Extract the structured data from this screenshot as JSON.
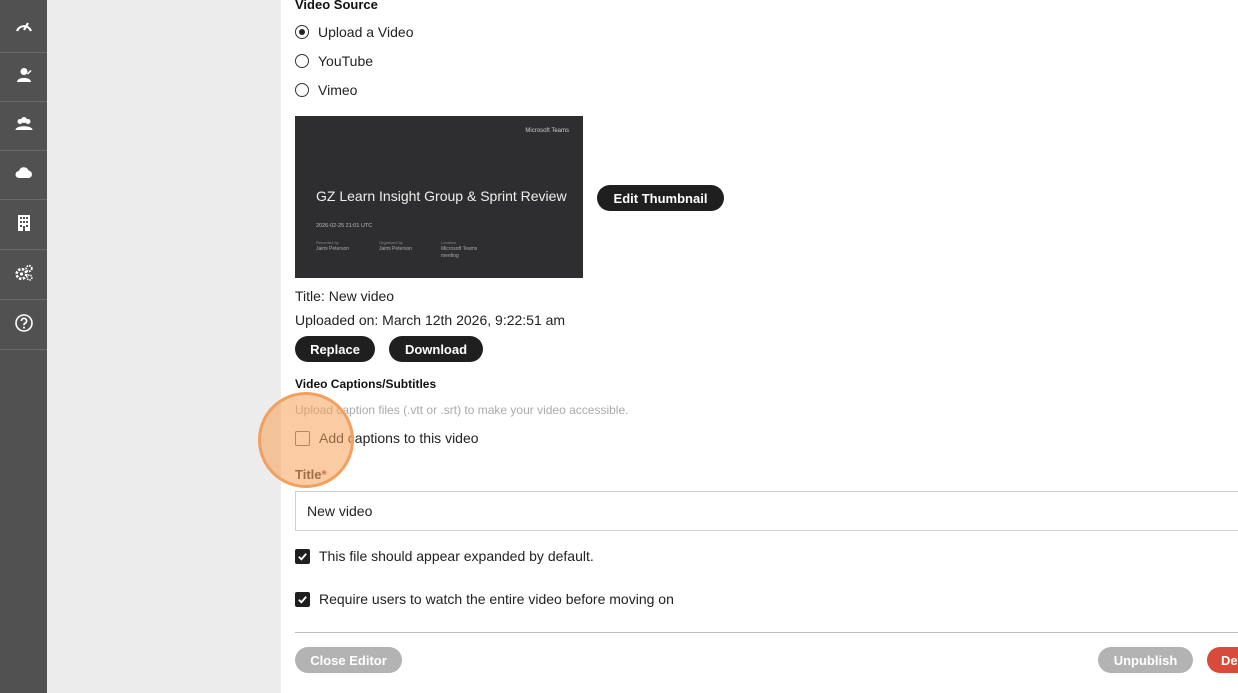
{
  "sidebar": {
    "items": [
      {
        "icon": "speedometer-icon"
      },
      {
        "icon": "user-icon"
      },
      {
        "icon": "users-group-icon"
      },
      {
        "icon": "cloud-icon"
      },
      {
        "icon": "building-icon"
      },
      {
        "icon": "gears-icon"
      },
      {
        "icon": "help-icon"
      }
    ]
  },
  "video_source": {
    "heading": "Video Source",
    "options": [
      {
        "label": "Upload a Video",
        "selected": true
      },
      {
        "label": "YouTube",
        "selected": false
      },
      {
        "label": "Vimeo",
        "selected": false
      }
    ]
  },
  "thumbnail": {
    "brand": "Microsoft Teams",
    "headline": "GZ Learn Insight Group & Sprint Review",
    "date": "2026-02-25 21:01 UTC",
    "meta": [
      {
        "label": "Recorded by",
        "value": "Jaimi Peterson"
      },
      {
        "label": "Organized by",
        "value": "Jaimi Peterson"
      },
      {
        "label": "Location",
        "value": "Microsoft Teams meeting"
      }
    ],
    "edit_button": "Edit Thumbnail"
  },
  "file_info": {
    "title_line": "Title: New video",
    "uploaded_line": "Uploaded on: March 12th 2026, 9:22:51 am",
    "replace_button": "Replace",
    "download_button": "Download"
  },
  "captions": {
    "heading": "Video Captions/Subtitles",
    "hint": "Upload caption files (.vtt or .srt) to make your video accessible.",
    "checkbox_label": "Add captions to this video",
    "checked": false
  },
  "title_field": {
    "label": "Title",
    "required_mark": "*",
    "value": "New video"
  },
  "options": {
    "expanded_label": "This file should appear expanded by default.",
    "expanded_checked": true,
    "require_watch_label": "Require users to watch the entire video before moving on",
    "require_watch_checked": true
  },
  "footer": {
    "close_button": "Close Editor",
    "unpublish_button": "Unpublish",
    "delete_button": "Delete"
  },
  "colors": {
    "sidebar": "#515151",
    "primary_button": "#1f1f1f",
    "muted_button": "#b3b3b3",
    "danger_button": "#d84a3a",
    "highlight": "#f2a05e"
  }
}
